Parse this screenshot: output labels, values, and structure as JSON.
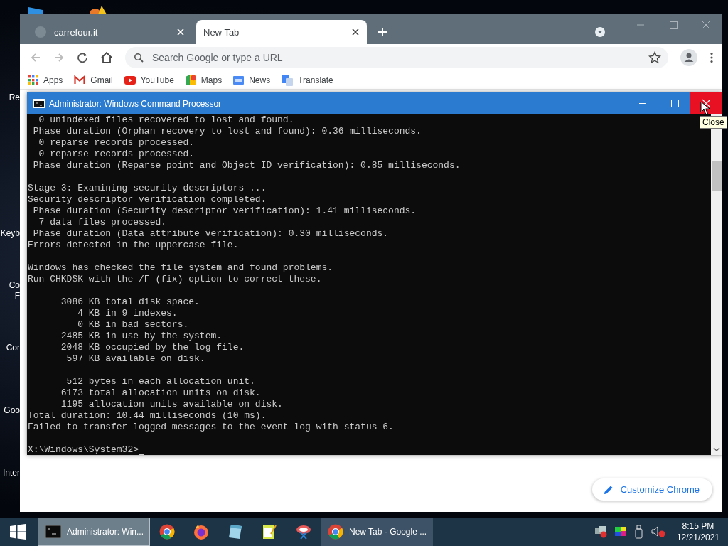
{
  "desktop": {
    "icon_labels": [
      {
        "lines": [
          "Re"
        ]
      },
      {
        "lines": [
          "Keyb"
        ]
      },
      {
        "lines": [
          "Co",
          "F"
        ]
      },
      {
        "lines": [
          "Cor"
        ]
      },
      {
        "lines": [
          "Goo"
        ]
      },
      {
        "lines": [
          "Inter"
        ]
      }
    ]
  },
  "browser": {
    "tabs": [
      {
        "title": "carrefour.it",
        "selected": false
      },
      {
        "title": "New Tab",
        "selected": true
      }
    ],
    "omnibox": {
      "placeholder": "Search Google or type a URL"
    },
    "bookmarks": [
      {
        "label": "Apps",
        "kind": "apps"
      },
      {
        "label": "Gmail",
        "kind": "gmail"
      },
      {
        "label": "YouTube",
        "kind": "youtube"
      },
      {
        "label": "Maps",
        "kind": "maps"
      },
      {
        "label": "News",
        "kind": "news"
      },
      {
        "label": "Translate",
        "kind": "translate"
      }
    ],
    "customize_button": "Customize Chrome"
  },
  "console": {
    "title": "Administrator: Windows Command Processor",
    "tooltip": "Close",
    "blocks": [
      [
        "  0 unindexed files recovered to lost and found.",
        " Phase duration (Orphan recovery to lost and found): 0.36 milliseconds.",
        "  0 reparse records processed.",
        "  0 reparse records processed.",
        " Phase duration (Reparse point and Object ID verification): 0.85 milliseconds."
      ],
      [
        "Stage 3: Examining security descriptors ...",
        "Security descriptor verification completed.",
        " Phase duration (Security descriptor verification): 1.41 milliseconds.",
        "  7 data files processed.",
        " Phase duration (Data attribute verification): 0.30 milliseconds.",
        "Errors detected in the uppercase file."
      ],
      [
        "Windows has checked the file system and found problems.",
        "Run CHKDSK with the /F (fix) option to correct these."
      ],
      [
        "      3086 KB total disk space.",
        "         4 KB in 9 indexes.",
        "         0 KB in bad sectors.",
        "      2485 KB in use by the system.",
        "      2048 KB occupied by the log file.",
        "       597 KB available on disk."
      ],
      [
        "       512 bytes in each allocation unit.",
        "      6173 total allocation units on disk.",
        "      1195 allocation units available on disk.",
        "Total duration: 10.44 milliseconds (10 ms).",
        "Failed to transfer logged messages to the event log with status 6."
      ]
    ],
    "prompt": "X:\\Windows\\System32>"
  },
  "taskbar": {
    "items": [
      {
        "kind": "cmd",
        "label": "Administrator: Win...",
        "selected": true
      },
      {
        "kind": "chrome",
        "selected": false
      },
      {
        "kind": "firefox",
        "selected": false
      },
      {
        "kind": "notepad",
        "selected": false
      },
      {
        "kind": "editor",
        "selected": false
      },
      {
        "kind": "snip",
        "selected": false
      },
      {
        "kind": "chrome",
        "label": "New Tab - Google ...",
        "selected": false
      }
    ],
    "time": "8:15 PM",
    "date": "12/21/2021"
  }
}
